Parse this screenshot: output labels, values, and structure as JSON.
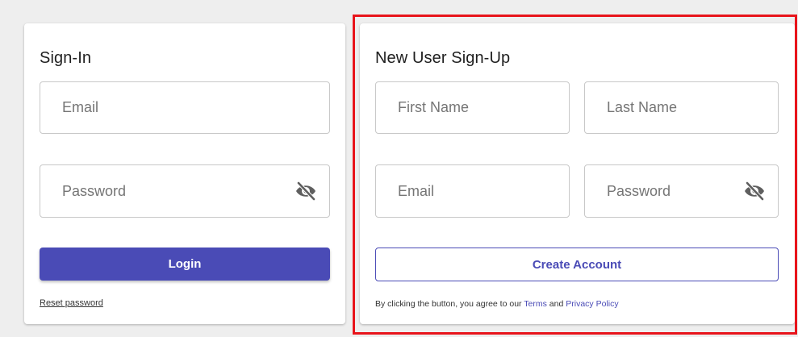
{
  "signin": {
    "title": "Sign-In",
    "email_placeholder": "Email",
    "password_placeholder": "Password",
    "login_label": "Login",
    "reset_label": "Reset password"
  },
  "signup": {
    "title": "New User Sign-Up",
    "first_name_placeholder": "First Name",
    "last_name_placeholder": "Last Name",
    "email_placeholder": "Email",
    "password_placeholder": "Password",
    "create_label": "Create Account",
    "terms_prefix": "By clicking the button, you agree to our",
    "terms_link": "Terms",
    "terms_and": "and",
    "privacy_link": "Privacy Policy"
  },
  "icons": {
    "password_toggle": "eye-off-icon"
  },
  "colors": {
    "accent": "#4a4bb6",
    "highlight": "#e8141b",
    "background": "#eeeeee"
  }
}
